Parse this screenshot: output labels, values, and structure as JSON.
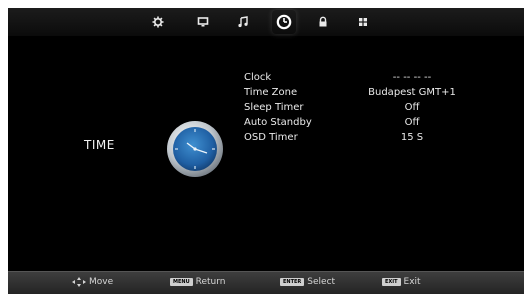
{
  "tabs": [
    {
      "icon": "gear-icon"
    },
    {
      "icon": "monitor-icon"
    },
    {
      "icon": "music-note-icon"
    },
    {
      "icon": "clock-icon",
      "active": true
    },
    {
      "icon": "lock-icon"
    },
    {
      "icon": "grid-icon"
    }
  ],
  "category": {
    "label": "TIME",
    "icon": "clock-icon"
  },
  "menu": {
    "items": [
      {
        "label": "Clock",
        "value": "-- --   -- --"
      },
      {
        "label": "Time Zone",
        "value": "Budapest GMT+1"
      },
      {
        "label": "Sleep Timer",
        "value": "Off"
      },
      {
        "label": "Auto Standby",
        "value": "Off"
      },
      {
        "label": "OSD Timer",
        "value": "15 S"
      }
    ]
  },
  "footer": {
    "move": {
      "icon": "directional-pad-icon",
      "label": "Move"
    },
    "return": {
      "key": "MENU",
      "label": "Return"
    },
    "select": {
      "key": "ENTER",
      "label": "Select"
    },
    "exit": {
      "key": "EXIT",
      "label": "Exit"
    }
  },
  "colors": {
    "background": "#000000",
    "text": "#eaeaea",
    "footer": "#2f2f2f"
  }
}
